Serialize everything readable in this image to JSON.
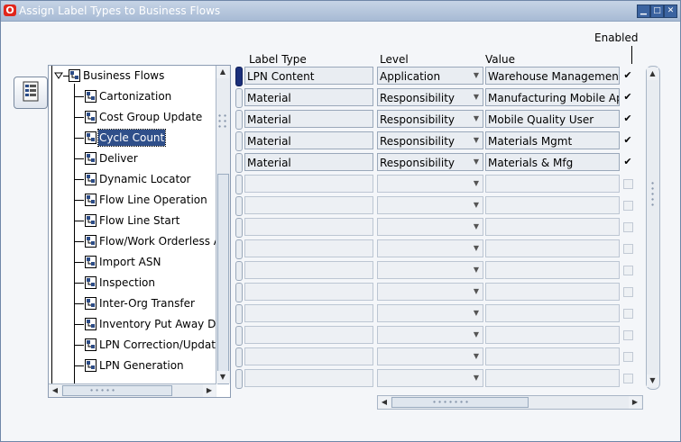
{
  "window": {
    "title": "Assign Label Types to Business Flows",
    "logo": "O"
  },
  "colors": {
    "selection": "#2f4f8a",
    "title_gradient_top": "#c6d4e6",
    "row_current": "#1b2f7a"
  },
  "tree": {
    "root": "Business Flows",
    "items": [
      "Cartonization",
      "Cost Group Update",
      "Cycle Count",
      "Deliver",
      "Dynamic Locator",
      "Flow Line Operation",
      "Flow Line Start",
      "Flow/Work Orderless A",
      "Import ASN",
      "Inspection",
      "Inter-Org Transfer",
      "Inventory Put Away Dr",
      "LPN Correction/Update",
      "LPN Generation"
    ],
    "selected": "Cycle Count"
  },
  "table": {
    "headers": {
      "label_type": "Label Type",
      "level": "Level",
      "value": "Value",
      "enabled": "Enabled"
    },
    "rows": [
      {
        "label_type": "LPN Content",
        "level": "Application",
        "value": "Warehouse Management",
        "enabled": true
      },
      {
        "label_type": "Material",
        "level": "Responsibility",
        "value": "Manufacturing Mobile App",
        "enabled": true
      },
      {
        "label_type": "Material",
        "level": "Responsibility",
        "value": "Mobile Quality User",
        "enabled": true
      },
      {
        "label_type": "Material",
        "level": "Responsibility",
        "value": "Materials Mgmt",
        "enabled": true
      },
      {
        "label_type": "Material",
        "level": "Responsibility",
        "value": "Materials & Mfg",
        "enabled": true
      }
    ],
    "empty_row_count": 10
  },
  "icons": {
    "tree_node": "flow-node-icon",
    "toolbar": "assign-list-icon",
    "minimize": "minimize-icon",
    "maximize": "maximize-icon",
    "close": "close-icon"
  }
}
